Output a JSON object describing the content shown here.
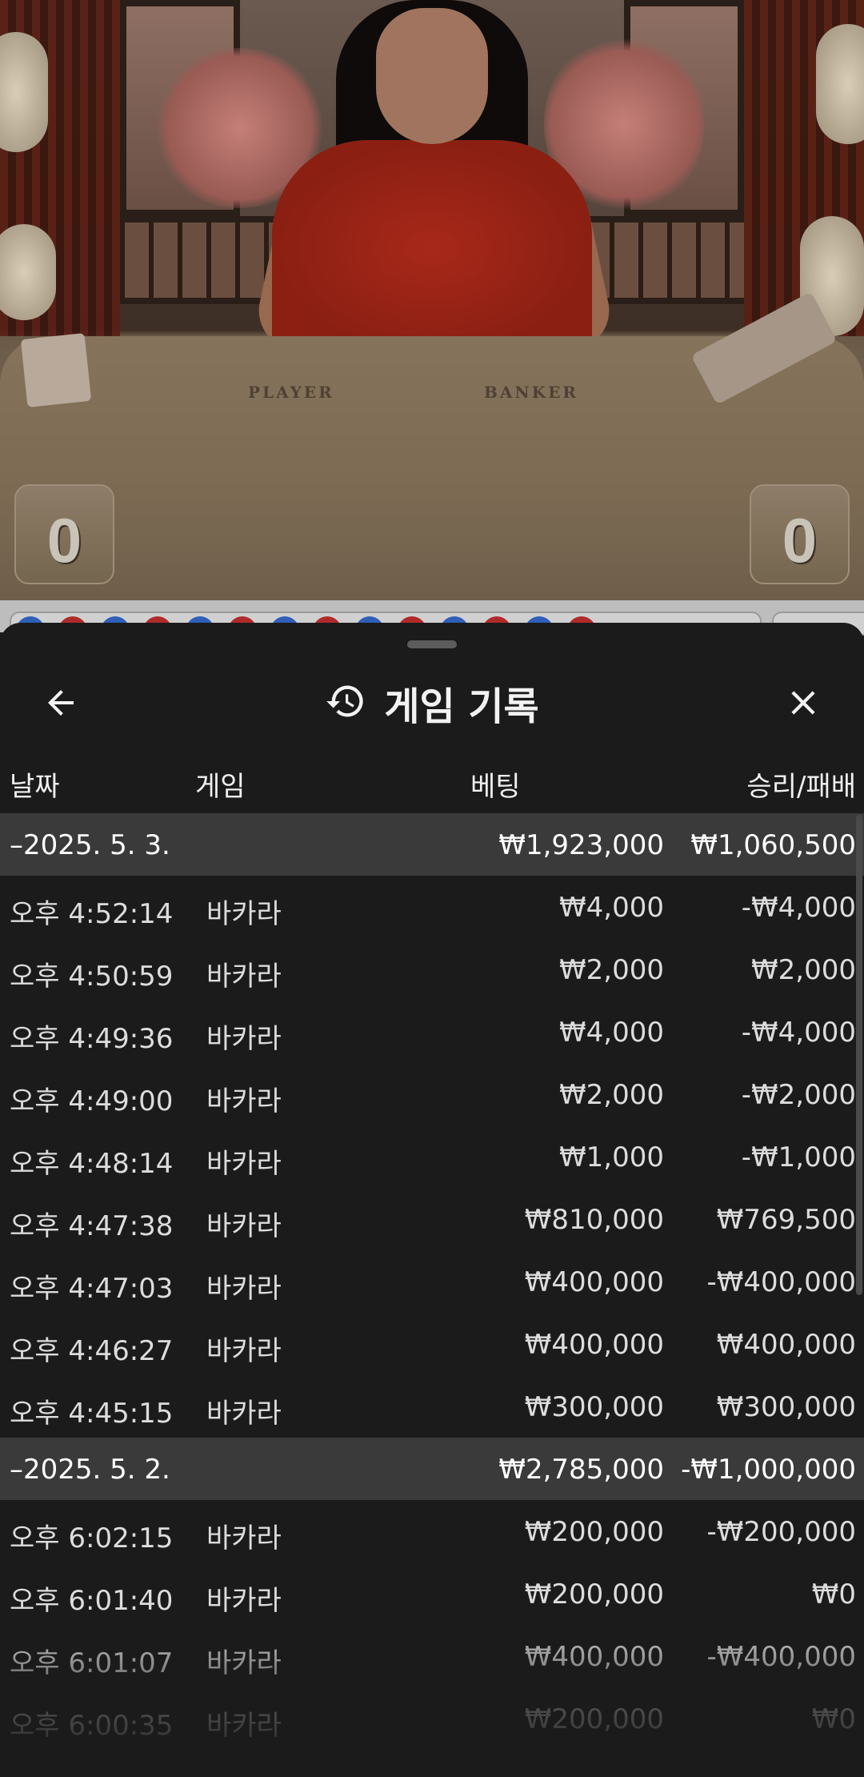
{
  "video": {
    "player_label": "PLAYER",
    "banker_label": "BANKER",
    "player_score": "0",
    "banker_score": "0"
  },
  "header": {
    "title": "게임 기록"
  },
  "columns": {
    "date": "날짜",
    "game": "게임",
    "bet": "베팅",
    "result": "승리/패배"
  },
  "groups": [
    {
      "date": "–2025. 5. 3.",
      "bet_total": "₩1,923,000",
      "result_total": "₩1,060,500",
      "rows": [
        {
          "time": "오후 4:52:14",
          "game": "바카라",
          "bet": "₩4,000",
          "result": "-₩4,000"
        },
        {
          "time": "오후 4:50:59",
          "game": "바카라",
          "bet": "₩2,000",
          "result": "₩2,000"
        },
        {
          "time": "오후 4:49:36",
          "game": "바카라",
          "bet": "₩4,000",
          "result": "-₩4,000"
        },
        {
          "time": "오후 4:49:00",
          "game": "바카라",
          "bet": "₩2,000",
          "result": "-₩2,000"
        },
        {
          "time": "오후 4:48:14",
          "game": "바카라",
          "bet": "₩1,000",
          "result": "-₩1,000"
        },
        {
          "time": "오후 4:47:38",
          "game": "바카라",
          "bet": "₩810,000",
          "result": "₩769,500"
        },
        {
          "time": "오후 4:47:03",
          "game": "바카라",
          "bet": "₩400,000",
          "result": "-₩400,000"
        },
        {
          "time": "오후 4:46:27",
          "game": "바카라",
          "bet": "₩400,000",
          "result": "₩400,000"
        },
        {
          "time": "오후 4:45:15",
          "game": "바카라",
          "bet": "₩300,000",
          "result": "₩300,000"
        }
      ]
    },
    {
      "date": "–2025. 5. 2.",
      "bet_total": "₩2,785,000",
      "result_total": "-₩1,000,000",
      "rows": [
        {
          "time": "오후 6:02:15",
          "game": "바카라",
          "bet": "₩200,000",
          "result": "-₩200,000"
        },
        {
          "time": "오후 6:01:40",
          "game": "바카라",
          "bet": "₩200,000",
          "result": "₩0"
        },
        {
          "time": "오후 6:01:07",
          "game": "바카라",
          "bet": "₩400,000",
          "result": "-₩400,000"
        },
        {
          "time": "오후 6:00:35",
          "game": "바카라",
          "bet": "₩200,000",
          "result": "₩0"
        }
      ]
    }
  ],
  "roadmap": [
    "blue",
    "red",
    "blue",
    "red",
    "blue",
    "red",
    "blue",
    "red",
    "blue",
    "red",
    "blue",
    "red",
    "blue",
    "red"
  ],
  "colors": {
    "background": "#1b1b1b",
    "group_row": "#3a3a3a",
    "roadmap_blue": "#2f5fb8",
    "roadmap_red": "#b02a2a"
  }
}
